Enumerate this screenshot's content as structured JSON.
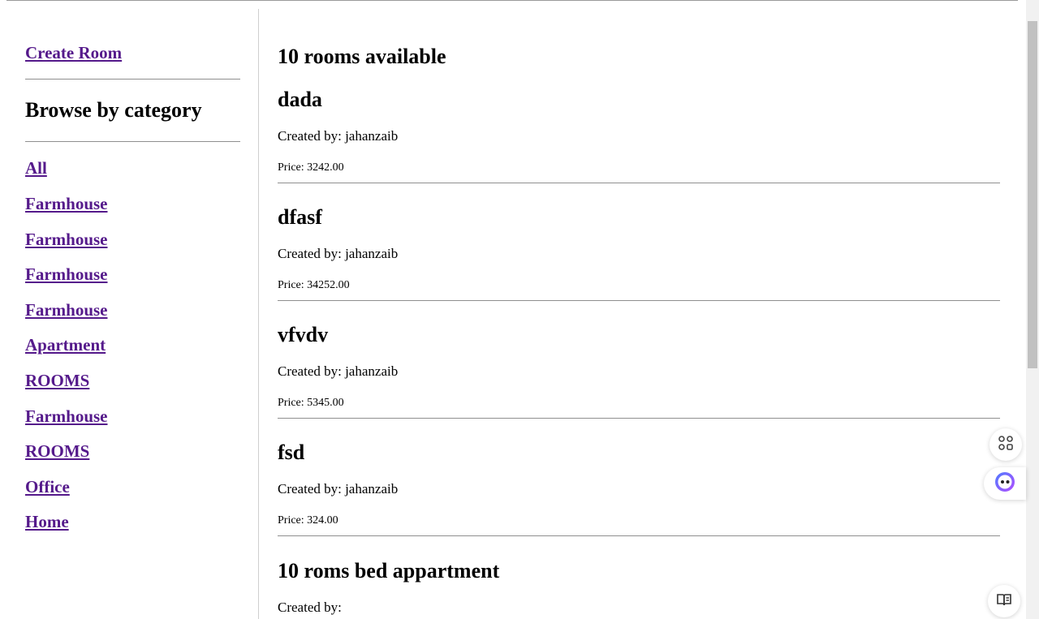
{
  "sidebar": {
    "create_room": "Create Room",
    "heading": "Browse by category",
    "categories": [
      "All",
      "Farmhouse",
      "Farmhouse",
      "Farmhouse",
      "Farmhouse",
      "Apartment",
      "ROOMS",
      "Farmhouse",
      "ROOMS",
      "Office",
      "Home"
    ]
  },
  "main": {
    "count_text": "10 rooms available",
    "rooms": [
      {
        "name": "dada",
        "creator": "Created by: jahanzaib",
        "price": "Price: 3242.00"
      },
      {
        "name": "dfasf",
        "creator": "Created by: jahanzaib",
        "price": "Price: 34252.00"
      },
      {
        "name": "vfvdv",
        "creator": "Created by: jahanzaib",
        "price": "Price: 5345.00"
      },
      {
        "name": "fsd",
        "creator": "Created by: jahanzaib",
        "price": "Price: 324.00"
      },
      {
        "name": "10 roms bed appartment",
        "creator": "Created by:",
        "price": ""
      }
    ]
  },
  "floating": {
    "apps_icon": "grid-apps-icon",
    "assistant_icon": "assistant-face-icon",
    "reader_icon": "book-reader-icon"
  },
  "colors": {
    "link": "#551a8b",
    "accent": "#7b4dff"
  }
}
